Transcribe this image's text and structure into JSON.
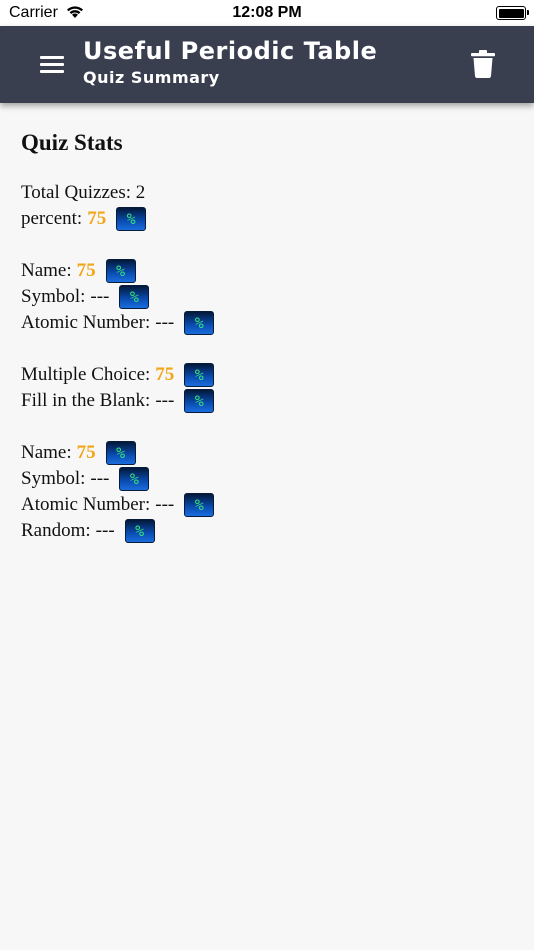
{
  "status_bar": {
    "carrier": "Carrier",
    "time": "12:08 PM"
  },
  "header": {
    "title": "Useful Periodic Table",
    "subtitle": "Quiz Summary",
    "menu_icon": "menu-icon",
    "action_icon": "trash-icon"
  },
  "stats": {
    "heading": "Quiz Stats",
    "total_quizzes": "Total Quizzes: 2",
    "percent_label": "percent:",
    "percent_value": "75",
    "pct_button_label": "%",
    "by_question_type": [
      {
        "label": "Name:",
        "value": "75"
      },
      {
        "label": "Symbol:",
        "value": "---"
      },
      {
        "label": "Atomic Number:",
        "value": "---"
      }
    ],
    "by_answer_type": [
      {
        "label": "Multiple Choice:",
        "value": "75"
      },
      {
        "label": "Fill in the Blank:",
        "value": "---"
      }
    ],
    "by_quiz_mode": [
      {
        "label": "Name:",
        "value": "75"
      },
      {
        "label": "Symbol:",
        "value": "---"
      },
      {
        "label": "Atomic Number:",
        "value": "---"
      },
      {
        "label": "Random:",
        "value": "---"
      }
    ]
  },
  "colors": {
    "app_bar": "#3a3f50",
    "highlight_value": "#f2a516",
    "pct_button_text": "#33e07a"
  }
}
